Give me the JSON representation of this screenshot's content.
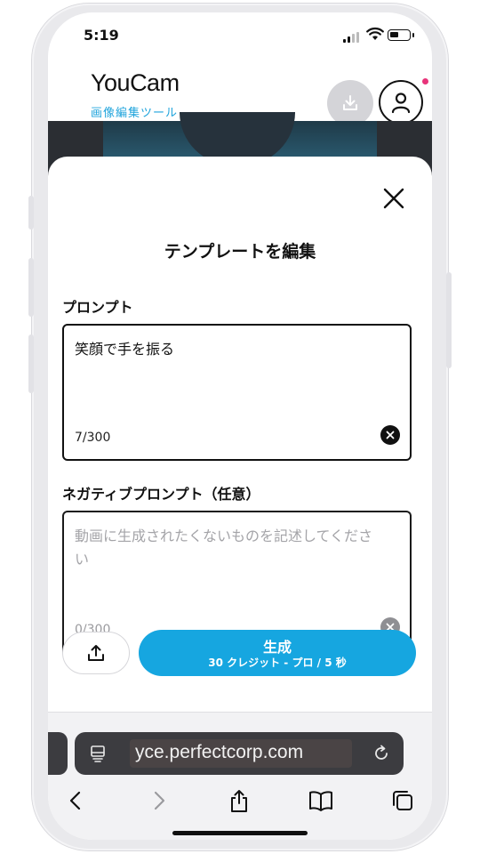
{
  "status_bar": {
    "time": "5:19"
  },
  "app_header": {
    "logo": "YouCam",
    "subtitle": "画像編集ツール",
    "download_icon": "download-icon",
    "profile_icon": "user-icon"
  },
  "sheet": {
    "title": "テンプレートを編集",
    "close_icon": "close-icon",
    "prompt": {
      "label": "プロンプト",
      "value": "笑顔で手を振る",
      "count": "7/300"
    },
    "negative_prompt": {
      "label": "ネガティブプロンプト（任意）",
      "placeholder": "動画に生成されたくないものを記述してください",
      "count": "0/300"
    },
    "upload_icon": "upload-icon",
    "generate": {
      "label": "生成",
      "sub": "30 クレジット - プロ / 5 秒"
    }
  },
  "safari": {
    "url": "yce.perfectcorp.com",
    "nav": [
      "back-icon",
      "forward-icon",
      "share-icon",
      "bookmarks-icon",
      "tabs-icon"
    ]
  },
  "colors": {
    "accent": "#16a6e0",
    "logo_sub": "#20a4dc",
    "notification": "#e8347a"
  }
}
